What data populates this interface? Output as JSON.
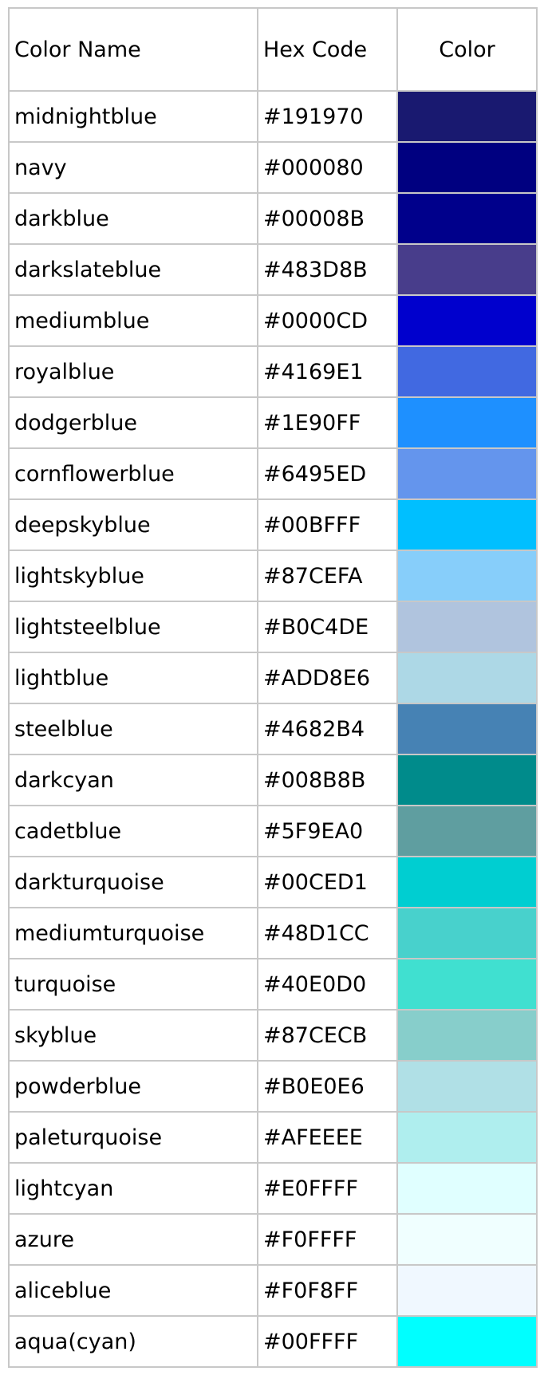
{
  "table": {
    "headers": {
      "name": "Color Name",
      "hex": "Hex Code",
      "color": "Color"
    },
    "rows": [
      {
        "name": "midnightblue",
        "hex": "#191970",
        "swatch": "#191970"
      },
      {
        "name": "navy",
        "hex": "#000080",
        "swatch": "#000080"
      },
      {
        "name": "darkblue",
        "hex": "#00008B",
        "swatch": "#00008B"
      },
      {
        "name": "darkslateblue",
        "hex": "#483D8B",
        "swatch": "#483D8B"
      },
      {
        "name": "mediumblue",
        "hex": "#0000CD",
        "swatch": "#0000CD"
      },
      {
        "name": "royalblue",
        "hex": "#4169E1",
        "swatch": "#4169E1"
      },
      {
        "name": "dodgerblue",
        "hex": "#1E90FF",
        "swatch": "#1E90FF"
      },
      {
        "name": "cornflowerblue",
        "hex": "#6495ED",
        "swatch": "#6495ED"
      },
      {
        "name": "deepskyblue",
        "hex": "#00BFFF",
        "swatch": "#00BFFF"
      },
      {
        "name": "lightskyblue",
        "hex": "#87CEFA",
        "swatch": "#87CEFA"
      },
      {
        "name": "lightsteelblue",
        "hex": "#B0C4DE",
        "swatch": "#B0C4DE"
      },
      {
        "name": "lightblue",
        "hex": "#ADD8E6",
        "swatch": "#ADD8E6"
      },
      {
        "name": "steelblue",
        "hex": "#4682B4",
        "swatch": "#4682B4"
      },
      {
        "name": "darkcyan",
        "hex": "#008B8B",
        "swatch": "#008B8B"
      },
      {
        "name": "cadetblue",
        "hex": "#5F9EA0",
        "swatch": "#5F9EA0"
      },
      {
        "name": "darkturquoise",
        "hex": "#00CED1",
        "swatch": "#00CED1"
      },
      {
        "name": "mediumturquoise",
        "hex": "#48D1CC",
        "swatch": "#48D1CC"
      },
      {
        "name": "turquoise",
        "hex": "#40E0D0",
        "swatch": "#40E0D0"
      },
      {
        "name": "skyblue",
        "hex": "#87CECB",
        "swatch": "#87CECB"
      },
      {
        "name": "powderblue",
        "hex": "#B0E0E6",
        "swatch": "#B0E0E6"
      },
      {
        "name": "paleturquoise",
        "hex": "#AFEEEE",
        "swatch": "#AFEEEE"
      },
      {
        "name": "lightcyan",
        "hex": "#E0FFFF",
        "swatch": "#E0FFFF"
      },
      {
        "name": "azure",
        "hex": "#F0FFFF",
        "swatch": "#F0FFFF"
      },
      {
        "name": "aliceblue",
        "hex": "#F0F8FF",
        "swatch": "#F0F8FF"
      },
      {
        "name": "aqua(cyan)",
        "hex": "#00FFFF",
        "swatch": "#00FFFF"
      }
    ]
  }
}
